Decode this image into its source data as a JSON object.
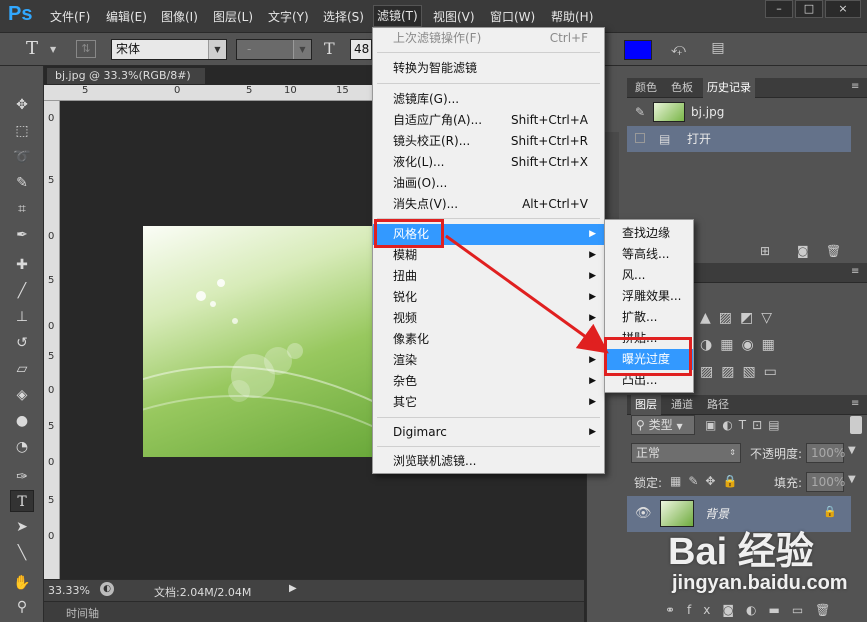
{
  "app": {
    "logo": "Ps",
    "menus": [
      "文件(F)",
      "编辑(E)",
      "图像(I)",
      "图层(L)",
      "文字(Y)",
      "选择(S)",
      "滤镜(T)",
      "视图(V)",
      "窗口(W)",
      "帮助(H)"
    ],
    "active_menu": "滤镜(T)",
    "window_buttons": [
      "–",
      "□",
      "×"
    ]
  },
  "options": {
    "tool_letter": "T",
    "font_family": "宋体",
    "font_style": "-",
    "font_size": "48",
    "accent_color": "#0000ff"
  },
  "document": {
    "tab_title": "bj.jpg @ 33.3%(RGB/8#)",
    "tab_close": "×",
    "ruler_top": [
      "5",
      "0",
      "5",
      "10",
      "15"
    ],
    "ruler_left": [
      "0",
      "5",
      "0",
      "5",
      "0",
      "5",
      "0",
      "5",
      "0",
      "5",
      "0"
    ],
    "zoom": "33.33%",
    "doc_info": "文档:2.04M/2.04M",
    "timeline": "时间轴"
  },
  "filter_menu": {
    "items": [
      {
        "label": "上次滤镜操作(F)",
        "shortcut": "Ctrl+F",
        "disabled": true
      },
      {
        "label": "转换为智能滤镜",
        "shortcut": ""
      },
      {
        "label": "滤镜库(G)...",
        "shortcut": ""
      },
      {
        "label": "自适应广角(A)...",
        "shortcut": "Shift+Ctrl+A"
      },
      {
        "label": "镜头校正(R)...",
        "shortcut": "Shift+Ctrl+R"
      },
      {
        "label": "液化(L)...",
        "shortcut": "Shift+Ctrl+X"
      },
      {
        "label": "油画(O)...",
        "shortcut": ""
      },
      {
        "label": "消失点(V)...",
        "shortcut": "Alt+Ctrl+V"
      },
      {
        "label": "风格化",
        "submenu": true,
        "highlight": true
      },
      {
        "label": "模糊",
        "submenu": true
      },
      {
        "label": "扭曲",
        "submenu": true
      },
      {
        "label": "锐化",
        "submenu": true
      },
      {
        "label": "视频",
        "submenu": true
      },
      {
        "label": "像素化",
        "submenu": true
      },
      {
        "label": "渲染",
        "submenu": true
      },
      {
        "label": "杂色",
        "submenu": true
      },
      {
        "label": "其它",
        "submenu": true
      },
      {
        "label": "Digimarc",
        "submenu": true
      },
      {
        "label": "浏览联机滤镜..."
      }
    ],
    "highlight_color": "#3399ff"
  },
  "stylize_submenu": {
    "items": [
      "查找边缘",
      "等高线...",
      "风...",
      "浮雕效果...",
      "扩散...",
      "拼贴...",
      "曝光过度",
      "凸出..."
    ],
    "highlight_index": 6
  },
  "right_panels": {
    "history_tabs": [
      "颜色",
      "色板",
      "历史记录"
    ],
    "history_snapshot": "bj.jpg",
    "history_items": [
      "打开"
    ],
    "layer_tabs": [
      "图层",
      "通道",
      "路径"
    ],
    "filter_kind": "类型",
    "blend_mode": "正常",
    "opacity_label": "不透明度:",
    "opacity_value": "100%",
    "lock_label": "锁定:",
    "fill_label": "填充:",
    "fill_value": "100%",
    "layer_name": "背景"
  },
  "watermark": {
    "brand_text": "Bai 经验",
    "url": "jingyan.baidu.com"
  },
  "colors": {
    "menu_bg": "#3a3a3a",
    "panel_bg": "#535353",
    "doc_bg": "#282828",
    "highlight": "#3399ff",
    "annotation_red": "#e02020"
  }
}
